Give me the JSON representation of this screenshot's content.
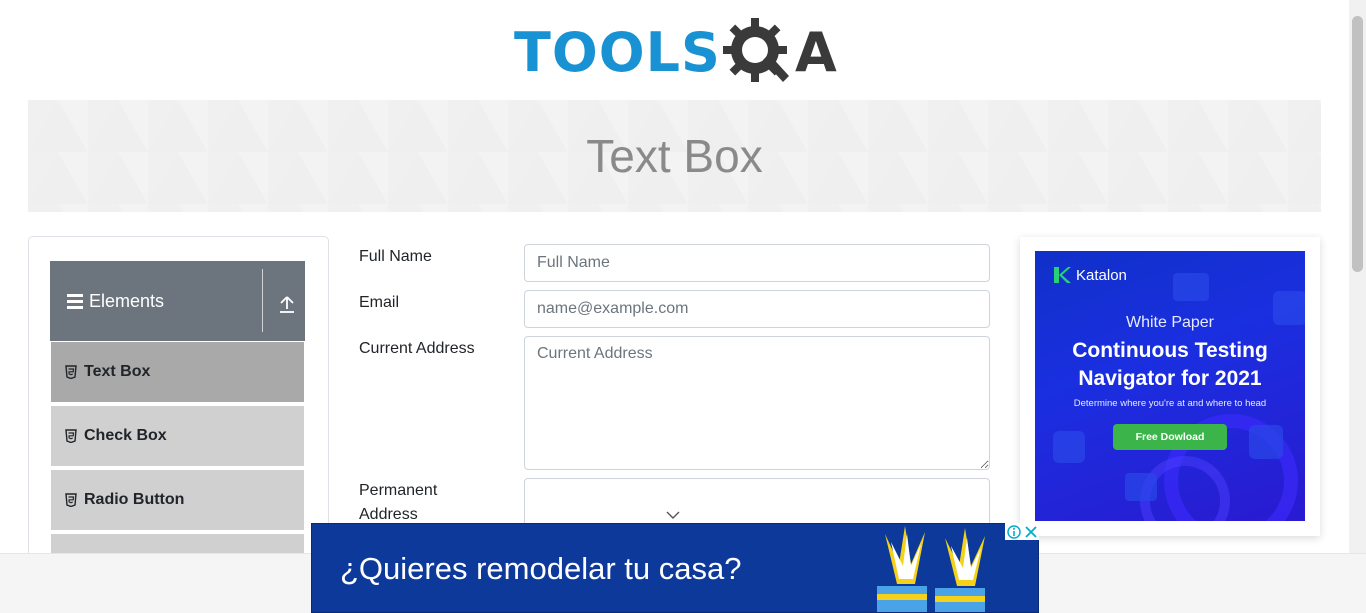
{
  "logo": {
    "part1": "TOOLS",
    "part2": "QA"
  },
  "banner": {
    "title": "Text Box"
  },
  "sidebar": {
    "group": {
      "label": "Elements"
    },
    "items": [
      {
        "label": "Text Box",
        "active": true
      },
      {
        "label": "Check Box",
        "active": false
      },
      {
        "label": "Radio Button",
        "active": false
      }
    ]
  },
  "form": {
    "full_name": {
      "label": "Full Name",
      "placeholder": "Full Name",
      "value": ""
    },
    "email": {
      "label": "Email",
      "placeholder": "name@example.com",
      "value": ""
    },
    "current_address": {
      "label": "Current Address",
      "placeholder": "Current Address",
      "value": ""
    },
    "permanent_address": {
      "label": "Permanent\nAddress",
      "value": ""
    }
  },
  "right_ad": {
    "brand": "Katalon",
    "kicker": "White Paper",
    "headline_line1": "Continuous Testing",
    "headline_line2": "Navigator for 2021",
    "sub": "Determine where you're at and where to head",
    "cta": "Free Dowload"
  },
  "bottom_ad": {
    "text": "¿Quieres remodelar tu casa?"
  },
  "colors": {
    "brand_blue": "#1992d4",
    "group_header": "#6c757d",
    "menu_item": "#d0d0d0",
    "menu_item_active": "#a9a9a9",
    "ad_blue": "#1a2fe0",
    "cta_green": "#3bb54a"
  }
}
